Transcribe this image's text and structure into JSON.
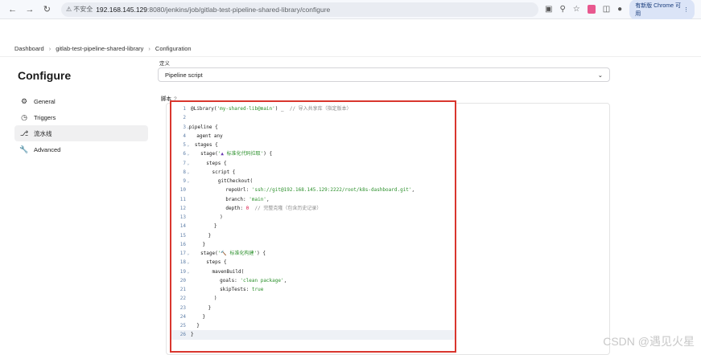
{
  "browser": {
    "security_label": "不安全",
    "url_host": "192.168.145.129",
    "url_path": ":8080/jenkins/job/gitlab-test-pipeline-shared-library/configure",
    "profile_label": "有新版 Chrome 可用"
  },
  "breadcrumb": {
    "items": [
      "Dashboard",
      "gitlab-test-pipeline-shared-library",
      "Configuration"
    ]
  },
  "page": {
    "title": "Configure"
  },
  "sidebar": {
    "items": [
      {
        "label": "General",
        "icon": "gear-icon"
      },
      {
        "label": "Triggers",
        "icon": "clock-icon"
      },
      {
        "label": "流水线",
        "icon": "pipeline-icon"
      },
      {
        "label": "Advanced",
        "icon": "wrench-icon"
      }
    ]
  },
  "definition": {
    "label": "定义",
    "selected": "Pipeline script"
  },
  "script": {
    "label": "脚本",
    "help": "?"
  },
  "code": [
    {
      "n": "1",
      "fold": false,
      "html": "@Library(<span class=\"str\">'my-shared-lib@main'</span>) _  <span class=\"cmt\">// 导入共享库（指定版本）</span>"
    },
    {
      "n": "2",
      "fold": false,
      "html": ""
    },
    {
      "n": "3",
      "fold": true,
      "html": "pipeline {"
    },
    {
      "n": "4",
      "fold": false,
      "html": "  agent any"
    },
    {
      "n": "5",
      "fold": true,
      "html": "  stages {"
    },
    {
      "n": "6",
      "fold": true,
      "html": "    stage(<span class=\"str\">'<span class=\"emo\">▲</span> 标准化代码拉取'</span>) {"
    },
    {
      "n": "7",
      "fold": true,
      "html": "      steps {"
    },
    {
      "n": "8",
      "fold": true,
      "html": "        script {"
    },
    {
      "n": "9",
      "fold": true,
      "html": "          gitCheckout("
    },
    {
      "n": "10",
      "fold": false,
      "html": "            repoUrl: <span class=\"str\">'ssh://git@192.168.145.129:2222/root/k8s-dashboard.git'</span>,"
    },
    {
      "n": "11",
      "fold": false,
      "html": "            branch: <span class=\"str\">'main'</span>,"
    },
    {
      "n": "12",
      "fold": false,
      "html": "            depth: <span class=\"num\">0</span>  <span class=\"cmt\">// 完整克隆（包含历史记录）</span>"
    },
    {
      "n": "13",
      "fold": false,
      "html": "          )"
    },
    {
      "n": "14",
      "fold": false,
      "html": "        }"
    },
    {
      "n": "15",
      "fold": false,
      "html": "      }"
    },
    {
      "n": "16",
      "fold": false,
      "html": "    }"
    },
    {
      "n": "17",
      "fold": true,
      "html": "    stage(<span class=\"str\">'<span class=\"emo\">🔨</span> 标准化构建'</span>) {"
    },
    {
      "n": "18",
      "fold": true,
      "html": "      steps {"
    },
    {
      "n": "19",
      "fold": true,
      "html": "        mavenBuild("
    },
    {
      "n": "20",
      "fold": false,
      "html": "          goals: <span class=\"str\">'clean package'</span>,"
    },
    {
      "n": "21",
      "fold": false,
      "html": "          skipTests: <span class=\"kw\">true</span>"
    },
    {
      "n": "22",
      "fold": false,
      "html": "        )"
    },
    {
      "n": "23",
      "fold": false,
      "html": "      }"
    },
    {
      "n": "24",
      "fold": false,
      "html": "    }"
    },
    {
      "n": "25",
      "fold": false,
      "html": "  }"
    },
    {
      "n": "26",
      "fold": false,
      "html": "}",
      "active": true
    }
  ],
  "watermark": "CSDN @遇见火星"
}
